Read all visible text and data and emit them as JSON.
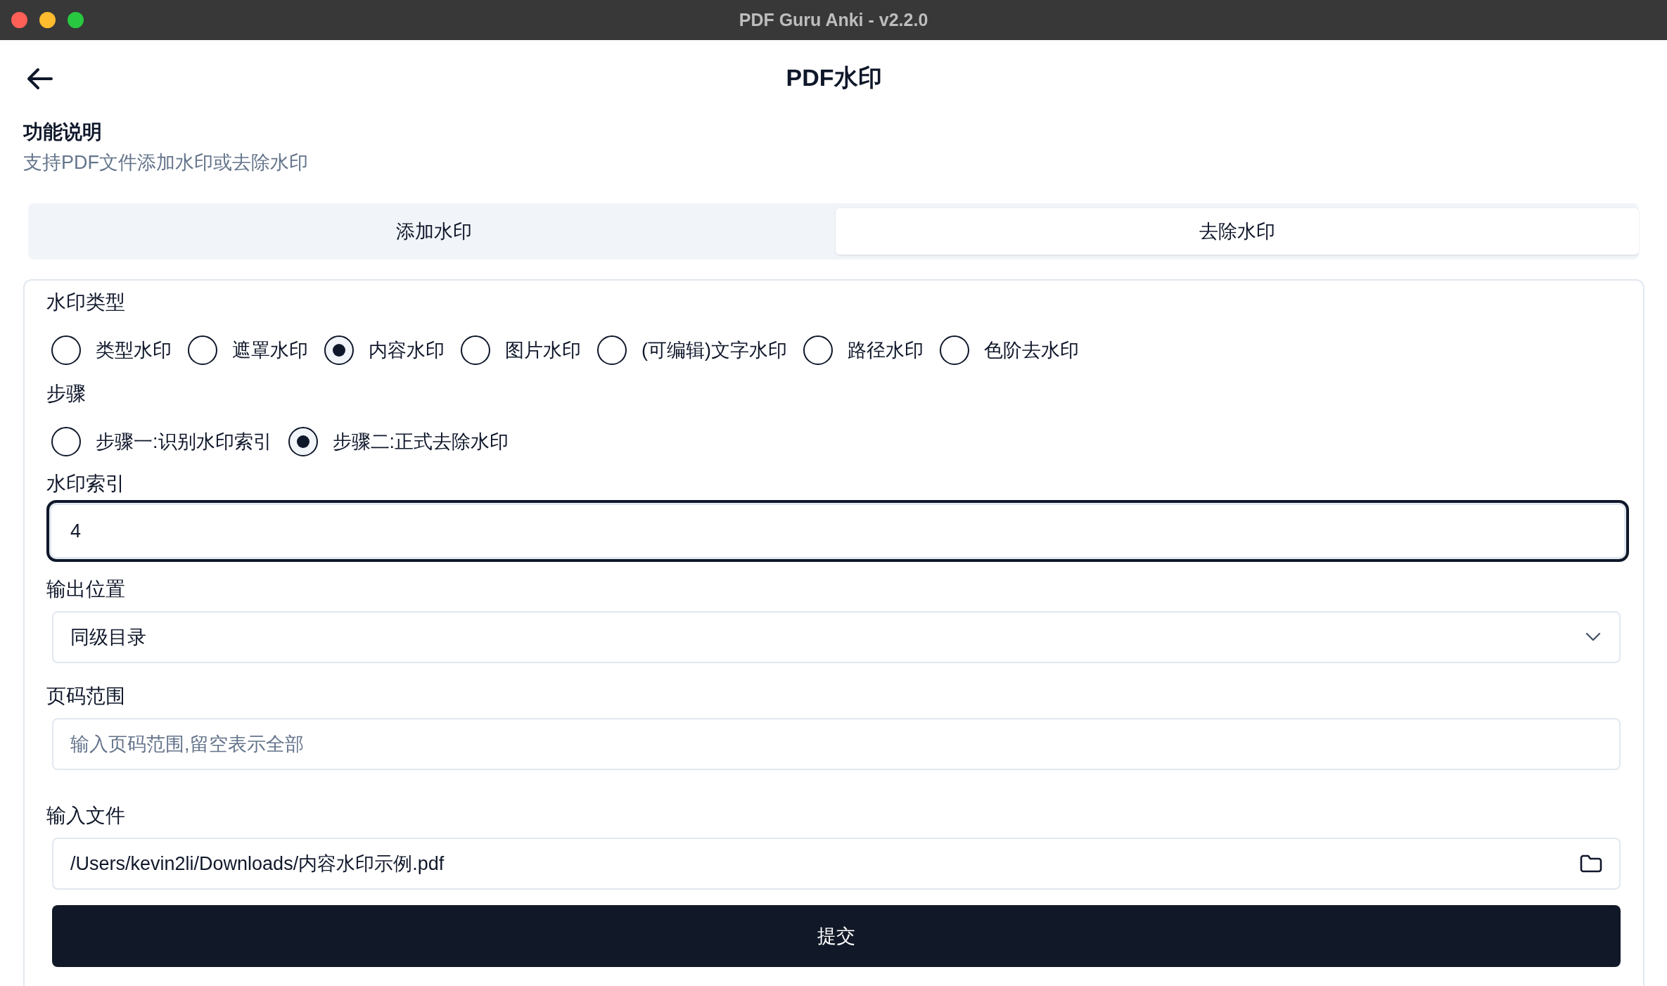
{
  "window": {
    "title": "PDF Guru Anki - v2.2.0"
  },
  "header": {
    "title": "PDF水印"
  },
  "description": {
    "heading": "功能说明",
    "text": "支持PDF文件添加水印或去除水印"
  },
  "tabs": [
    {
      "label": "添加水印",
      "selected": false
    },
    {
      "label": "去除水印",
      "selected": true
    }
  ],
  "form": {
    "watermark_type": {
      "label": "水印类型",
      "options": [
        {
          "label": "类型水印",
          "selected": false
        },
        {
          "label": "遮罩水印",
          "selected": false
        },
        {
          "label": "内容水印",
          "selected": true
        },
        {
          "label": "图片水印",
          "selected": false
        },
        {
          "label": "(可编辑)文字水印",
          "selected": false
        },
        {
          "label": "路径水印",
          "selected": false
        },
        {
          "label": "色阶去水印",
          "selected": false
        }
      ]
    },
    "step": {
      "label": "步骤",
      "options": [
        {
          "label": "步骤一:识别水印索引",
          "selected": false
        },
        {
          "label": "步骤二:正式去除水印",
          "selected": true
        }
      ]
    },
    "watermark_index": {
      "label": "水印索引",
      "value": "4",
      "focused": true
    },
    "output_location": {
      "label": "输出位置",
      "value": "同级目录"
    },
    "page_range": {
      "label": "页码范围",
      "placeholder": "输入页码范围,留空表示全部"
    },
    "input_file": {
      "label": "输入文件",
      "value": "/Users/kevin2li/Downloads/内容水印示例.pdf"
    },
    "submit": "提交"
  }
}
